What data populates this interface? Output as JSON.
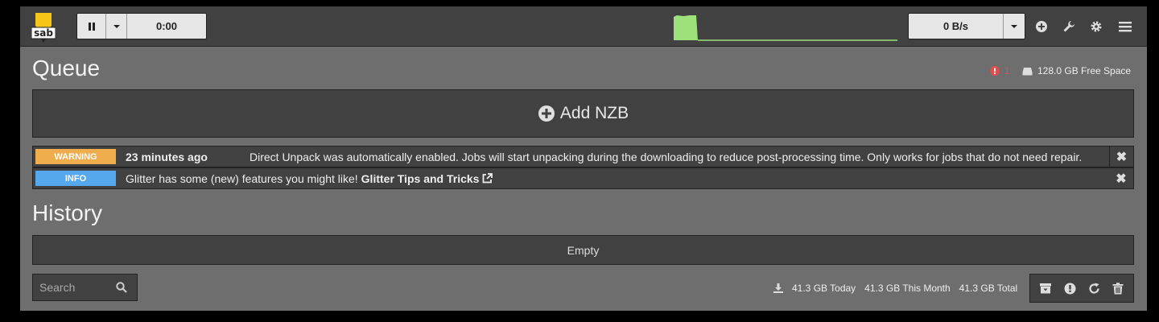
{
  "topbar": {
    "logo_text": "sab",
    "time_left": "0:00",
    "speed": "0 B/s"
  },
  "queue": {
    "title": "Queue",
    "warning_count": "1",
    "free_space": "128.0 GB Free Space",
    "add_nzb_label": "Add NZB"
  },
  "messages": [
    {
      "type": "WARNING",
      "time": "23 minutes ago",
      "text": "Direct Unpack was automatically enabled. Jobs will start unpacking during the downloading to reduce post-processing time. Only works for jobs that do not need repair."
    },
    {
      "type": "INFO",
      "text": "Glitter has some (new) features you might like!",
      "link": "Glitter Tips and Tricks"
    }
  ],
  "history": {
    "title": "History",
    "empty_text": "Empty",
    "search_placeholder": "Search",
    "stats": {
      "today": "41.3 GB Today",
      "month": "41.3 GB This Month",
      "total": "41.3 GB Total"
    }
  },
  "colors": {
    "warning": "#f0ad4e",
    "info": "#55a8ec",
    "error": "#e14d4d",
    "chart": "#9ee07a"
  }
}
